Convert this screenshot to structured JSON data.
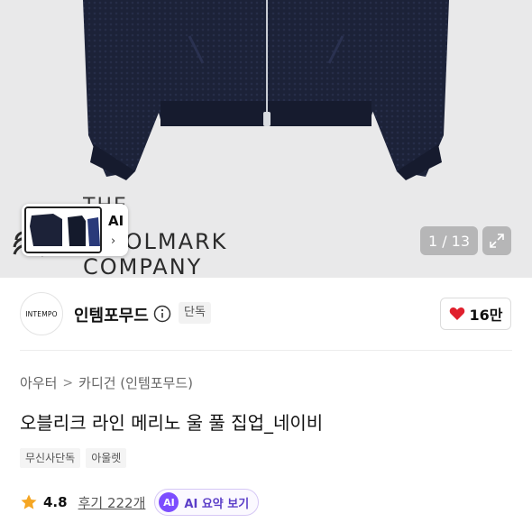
{
  "hero": {
    "brand_overlay_line1": "THE",
    "brand_overlay_line2": "WOOLMARK",
    "brand_overlay_line3": "COMPANY",
    "thumbnail_ai_label": "AI",
    "thumbnail_arrow": "›",
    "image_counter": "1 / 13",
    "expand_icon": "expand-icon"
  },
  "brand": {
    "logo_text": "INTEMPO",
    "name": "인템포무드",
    "badge": "단독",
    "likes": "16만"
  },
  "product": {
    "breadcrumb": [
      "아우터",
      "카디건 (인템포무드)"
    ],
    "breadcrumb_separator": ">",
    "title": "오블리크 라인 메리노 울 풀 집업_네이비",
    "tags": [
      "무신사단독",
      "아울렛"
    ],
    "rating": "4.8",
    "reviews": "후기 222개",
    "ai_badge": "AI",
    "ai_summary_label": "AI 요약 보기"
  },
  "colors": {
    "accent_heart": "#e0202d",
    "star": "#f5a623",
    "ai_purple": "#7c4dff",
    "jacket_navy": "#1c2238"
  }
}
